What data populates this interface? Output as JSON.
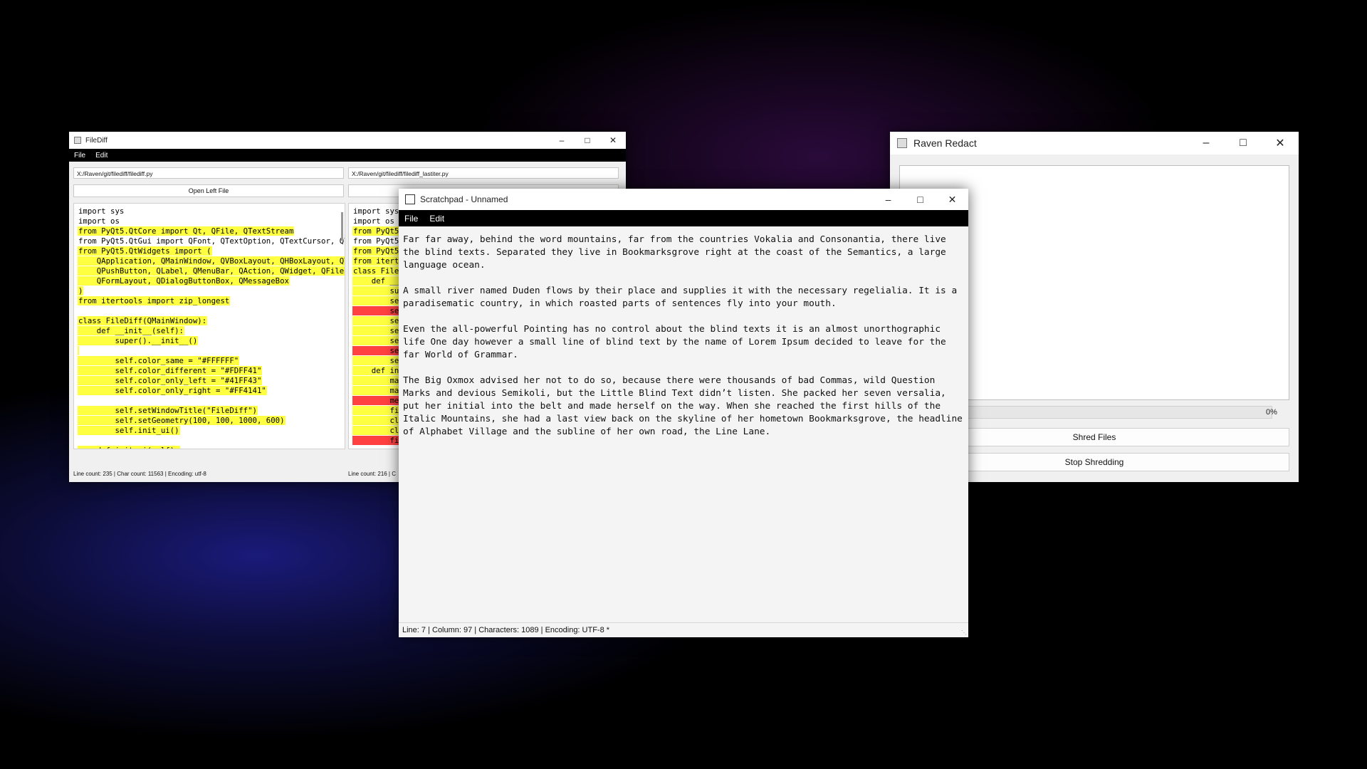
{
  "filediff": {
    "title": "FileDiff",
    "menu": [
      "File",
      "Edit"
    ],
    "left_path": "X:/Raven/git/filediff/filediff.py",
    "right_path": "X:/Raven/git/filediff/filediff_lastiter.py",
    "open_left_label": "Open Left File",
    "left_code": [
      {
        "text": "import sys",
        "hl": ""
      },
      {
        "text": "import os",
        "hl": ""
      },
      {
        "text": "from PyQt5.QtCore import Qt, QFile, QTextStream",
        "hl": "y"
      },
      {
        "text": "from PyQt5.QtGui import QFont, QTextOption, QTextCursor, QT",
        "hl": ""
      },
      {
        "text": "from PyQt5.QtWidgets import (",
        "hl": "y"
      },
      {
        "text": "    QApplication, QMainWindow, QVBoxLayout, QHBoxLayout, QT",
        "hl": "y"
      },
      {
        "text": "    QPushButton, QLabel, QMenuBar, QAction, QWidget, QFileD",
        "hl": "y"
      },
      {
        "text": "    QFormLayout, QDialogButtonBox, QMessageBox",
        "hl": "y"
      },
      {
        "text": ")",
        "hl": "y"
      },
      {
        "text": "from itertools import zip_longest",
        "hl": "y"
      },
      {
        "text": "",
        "hl": ""
      },
      {
        "text": "class FileDiff(QMainWindow):",
        "hl": "y"
      },
      {
        "text": "    def __init__(self):",
        "hl": "y"
      },
      {
        "text": "        super().__init__()",
        "hl": "y"
      },
      {
        "text": "",
        "hl": "y"
      },
      {
        "text": "        self.color_same = \"#FFFFFF\"",
        "hl": "y"
      },
      {
        "text": "        self.color_different = \"#FDFF41\"",
        "hl": "y"
      },
      {
        "text": "        self.color_only_left = \"#41FF43\"",
        "hl": "y"
      },
      {
        "text": "        self.color_only_right = \"#FF4141\"",
        "hl": "y"
      },
      {
        "text": "",
        "hl": ""
      },
      {
        "text": "        self.setWindowTitle(\"FileDiff\")",
        "hl": "y"
      },
      {
        "text": "        self.setGeometry(100, 100, 1000, 600)",
        "hl": "y"
      },
      {
        "text": "        self.init_ui()",
        "hl": "y"
      },
      {
        "text": "",
        "hl": ""
      },
      {
        "text": "    def init_ui(self):",
        "hl": "y"
      }
    ],
    "right_code": [
      {
        "text": "import sys",
        "hl": ""
      },
      {
        "text": "import os",
        "hl": ""
      },
      {
        "text": "from PyQt5",
        "hl": "y"
      },
      {
        "text": "from PyQt5",
        "hl": ""
      },
      {
        "text": "from PyQt5",
        "hl": "y"
      },
      {
        "text": "from itert",
        "hl": "y"
      },
      {
        "text": "class File",
        "hl": "y"
      },
      {
        "text": "    def __",
        "hl": "y"
      },
      {
        "text": "        su",
        "hl": "y"
      },
      {
        "text": "        se",
        "hl": "y"
      },
      {
        "text": "        se",
        "hl": "r"
      },
      {
        "text": "        se",
        "hl": "y"
      },
      {
        "text": "        se",
        "hl": "y"
      },
      {
        "text": "        se",
        "hl": "y"
      },
      {
        "text": "        se",
        "hl": "r"
      },
      {
        "text": "        se",
        "hl": "y"
      },
      {
        "text": "    def in",
        "hl": "y"
      },
      {
        "text": "        ma",
        "hl": "y"
      },
      {
        "text": "        ma",
        "hl": "y"
      },
      {
        "text": "        me",
        "hl": "r"
      },
      {
        "text": "        fi",
        "hl": "y"
      },
      {
        "text": "        cl",
        "hl": "y"
      },
      {
        "text": "        cl",
        "hl": "y"
      },
      {
        "text": "        fi",
        "hl": "r"
      },
      {
        "text": "",
        "hl": ""
      }
    ],
    "left_status": "Line count: 235 | Char count: 11563 | Encoding: utf-8",
    "right_status": "Line count: 216 | C"
  },
  "raven": {
    "title": "Raven Redact",
    "progress_percent": "0%",
    "progress_value": 0,
    "shred_label": "Shred Files",
    "stop_label": "Stop Shredding"
  },
  "scratchpad": {
    "title": "Scratchpad - Unnamed",
    "menu": [
      "File",
      "Edit"
    ],
    "paragraphs": [
      "Far far away, behind the word mountains, far from the countries Vokalia and Consonantia, there live the blind texts. Separated they live in Bookmarksgrove right at the coast of the Semantics, a large language ocean.",
      "A small river named Duden flows by their place and supplies it with the necessary regelialia. It is a paradisematic country, in which roasted parts of sentences fly into your mouth.",
      "Even the all-powerful Pointing has no control about the blind texts it is an almost unorthographic life One day however a small line of blind text by the name of Lorem Ipsum decided to leave for the far World of Grammar.",
      "The Big Oxmox advised her not to do so, because there were thousands of bad Commas, wild Question Marks and devious Semikoli, but the Little Blind Text didn’t listen. She packed her seven versalia, put her initial into the belt and made herself on the way. When she reached the first hills of the Italic Mountains, she had a last view back on the skyline of her hometown Bookmarksgrove, the headline of Alphabet Village and the subline of her own road, the Line Lane."
    ],
    "status": "Line: 7 | Column: 97 | Characters: 1089 | Encoding: UTF-8 *"
  },
  "icons": {
    "minimize": "minimize-icon",
    "maximize": "maximize-icon",
    "close": "close-icon"
  }
}
